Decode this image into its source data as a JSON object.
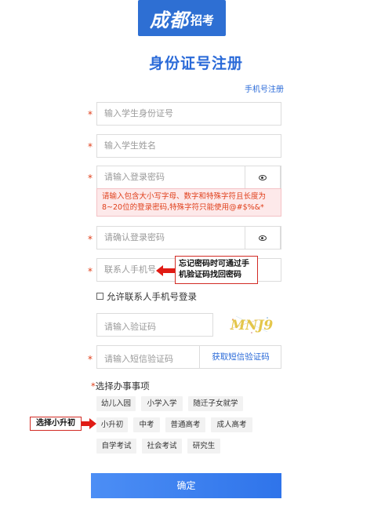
{
  "logo": {
    "big": "成都",
    "small": "招考"
  },
  "page_title": "身份证号注册",
  "switch_link": "手机号注册",
  "required_mark": "*",
  "fields": {
    "student_id": {
      "placeholder": "输入学生身份证号"
    },
    "student_name": {
      "placeholder": "输入学生姓名"
    },
    "password": {
      "placeholder": "请输入登录密码"
    },
    "password_hint": "请输入包含大小写字母、数字和特殊字符且长度为8~20位的登录密码,特殊字符只能使用@#$%&*",
    "confirm_password": {
      "placeholder": "请确认登录密码"
    },
    "contact_phone": {
      "placeholder": "联系人手机号"
    },
    "verify_code": {
      "placeholder": "请输入验证码"
    },
    "sms_code": {
      "placeholder": "请输入短信验证码",
      "button": "获取短信验证码"
    }
  },
  "annotation_phone": "忘记密码时可通过手机验证码找回密码",
  "allow_phone_login": {
    "checked": false,
    "label": "允许联系人手机号登录"
  },
  "captcha_text": "MNJ9",
  "section": {
    "label": "选择办事事项"
  },
  "tags_row1": [
    "幼儿入园",
    "小学入学",
    "随迁子女就学"
  ],
  "tags_row2": [
    "小升初",
    "中考",
    "普通高考",
    "成人高考"
  ],
  "tags_row3": [
    "自学考试",
    "社会考试",
    "研究生"
  ],
  "annotation_tag": "选择小升初",
  "submit": "确定",
  "colors": {
    "primary": "#2a6ad8",
    "required": "#e0401c",
    "annotation": "#d22b24"
  }
}
